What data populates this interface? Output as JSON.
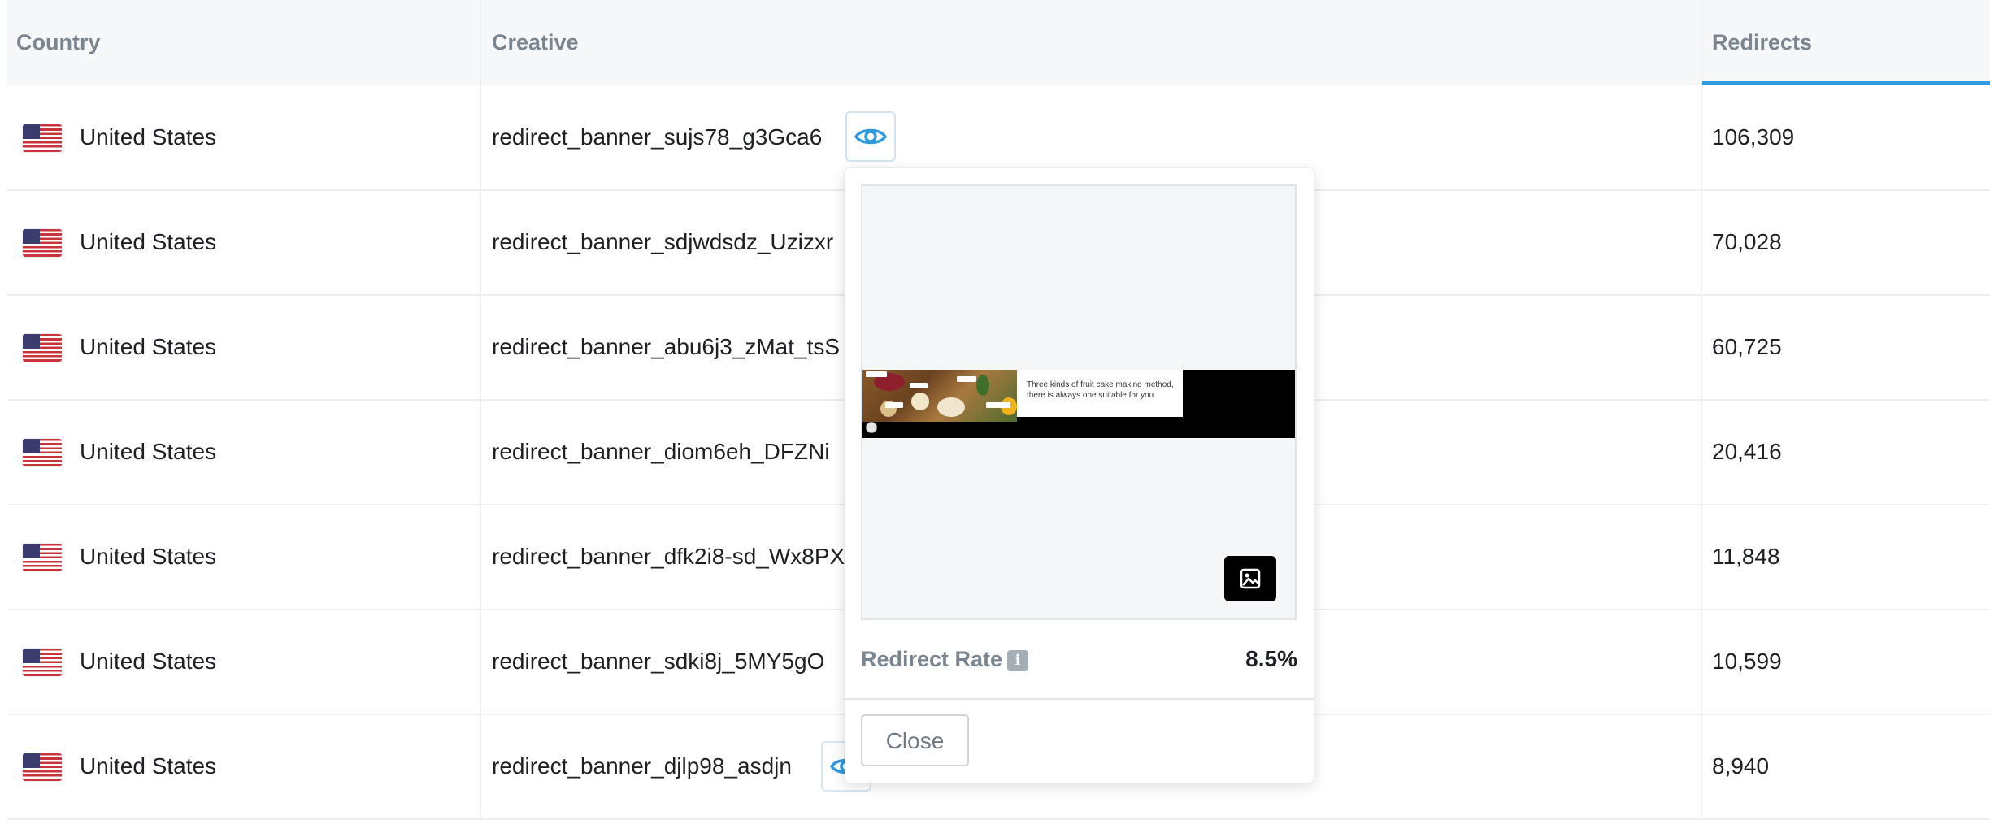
{
  "table": {
    "columns": {
      "country": "Country",
      "creative": "Creative",
      "redirects": "Redirects"
    },
    "rows": [
      {
        "country": "United States",
        "creative": "redirect_banner_sujs78_g3Gca6",
        "redirects": "106,309"
      },
      {
        "country": "United States",
        "creative": "redirect_banner_sdjwdsdz_Uzizxr",
        "redirects": "70,028"
      },
      {
        "country": "United States",
        "creative": "redirect_banner_abu6j3_zMat_tsS",
        "redirects": "60,725"
      },
      {
        "country": "United States",
        "creative": "redirect_banner_diom6eh_DFZNi",
        "redirects": "20,416"
      },
      {
        "country": "United States",
        "creative": "redirect_banner_dfk2i8-sd_Wx8PX",
        "redirects": "11,848"
      },
      {
        "country": "United States",
        "creative": "redirect_banner_sdki8j_5MY5gO",
        "redirects": "10,599"
      },
      {
        "country": "United States",
        "creative": "redirect_banner_djlp98_asdjn",
        "redirects": "8,940"
      }
    ]
  },
  "popover": {
    "banner_text": "Three kinds of fruit cake making method, there is always one suitable for you",
    "rate_label": "Redirect Rate",
    "info_symbol": "i",
    "rate_value": "8.5%",
    "close_label": "Close"
  },
  "colors": {
    "accent": "#2f9ae0",
    "header_bg": "#f6f7f8",
    "header_text": "#7b8590"
  },
  "icons": [
    "us-flag-icon",
    "eye-icon",
    "image-icon",
    "info-icon"
  ]
}
